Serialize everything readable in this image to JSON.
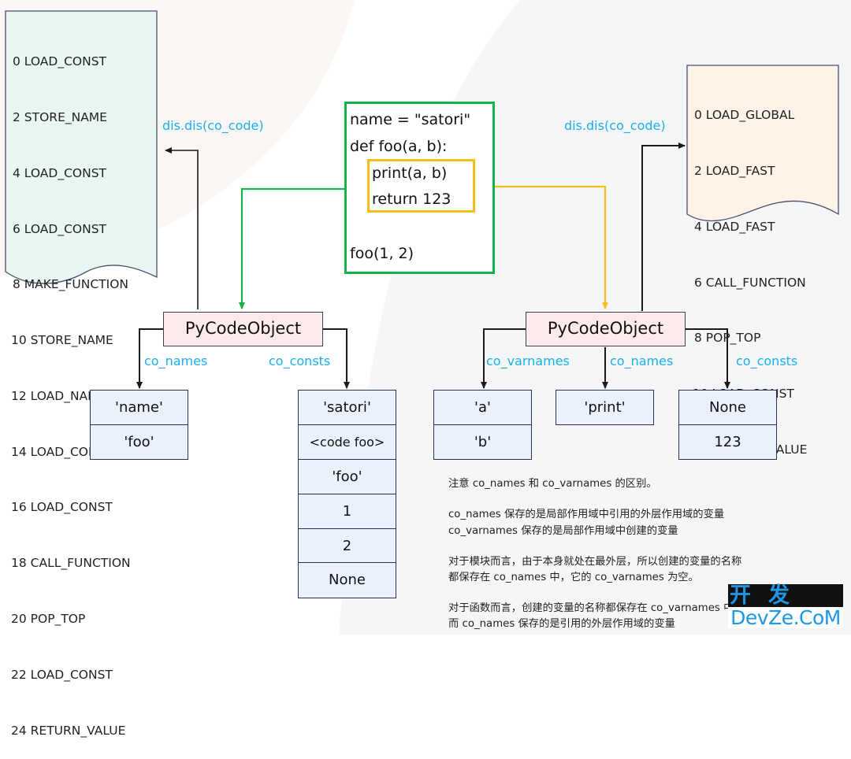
{
  "left_bytecode": {
    "instructions": [
      "0 LOAD_CONST",
      "2 STORE_NAME",
      "4 LOAD_CONST",
      "6 LOAD_CONST",
      "8 MAKE_FUNCTION",
      "10 STORE_NAME",
      "12 LOAD_NAME",
      "14 LOAD_CONST",
      "16 LOAD_CONST",
      "18 CALL_FUNCTION",
      "20 POP_TOP",
      "22 LOAD_CONST",
      "24 RETURN_VALUE"
    ],
    "arrow_label": "dis.dis(co_code)"
  },
  "right_bytecode": {
    "instructions": [
      "0 LOAD_GLOBAL",
      "2 LOAD_FAST",
      "4 LOAD_FAST",
      "6 CALL_FUNCTION",
      "8 POP_TOP",
      "10 LOAD_CONST",
      "12 RETURN_VALUE"
    ],
    "arrow_label": "dis.dis(co_code)"
  },
  "source_code": {
    "lines": [
      "name = \"satori\"",
      "def foo(a, b):",
      "print(a, b)",
      "return 123",
      "foo(1, 2)"
    ]
  },
  "module_code_object": {
    "title": "PyCodeObject",
    "co_names_label": "co_names",
    "co_consts_label": "co_consts",
    "co_names": [
      "'name'",
      "'foo'"
    ],
    "co_consts": [
      "'satori'",
      "<code foo>",
      "'foo'",
      "1",
      "2",
      "None"
    ]
  },
  "function_code_object": {
    "title": "PyCodeObject",
    "co_varnames_label": "co_varnames",
    "co_names_label": "co_names",
    "co_consts_label": "co_consts",
    "co_varnames": [
      "'a'",
      "'b'"
    ],
    "co_names": [
      "'print'"
    ],
    "co_consts": [
      "None",
      "123"
    ]
  },
  "notes": [
    "注意 co_names 和 co_varnames 的区别。",
    "co_names 保存的是局部作用域中引用的外层作用域的变量",
    "co_varnames 保存的是局部作用域中创建的变量",
    "对于模块而言，由于本身就处在最外层，所以创建的变量的名称",
    "都保存在 co_names 中，它的 co_varnames 为空。",
    "对于函数而言，创建的变量的名称都保存在 co_varnames 中，",
    "而 co_names 保存的是引用的外层作用域的变量"
  ],
  "watermark": {
    "cn": "开发者",
    "en": "DevZe.CoM"
  },
  "colors": {
    "module_arrow": "#15b34a",
    "function_arrow": "#f7be16",
    "label": "#1ab0ea",
    "code_object_fill": "#fdebeb",
    "cell_fill": "#eaf1fd",
    "left_doc_fill": "#e8f6f4",
    "right_doc_fill": "#fef3e6"
  }
}
